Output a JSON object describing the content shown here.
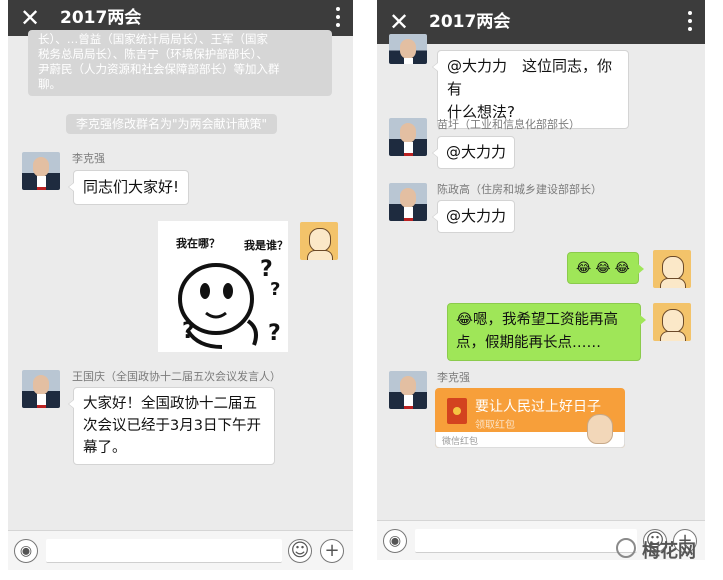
{
  "left": {
    "title": "2017两会",
    "close_icon": "close-icon",
    "more_icon": "more-vertical-icon",
    "sys_join": {
      "lines": [
        "长）、…曾益（国家统计局局长）、王军（国家",
        "税务总局局长）、陈吉宁（环境保护部部长）、",
        "尹蔚民（人力资源和社会保障部部长）等加入群",
        "聊。"
      ]
    },
    "sys_rename": "李克强修改群名为\"为两会献计献策\"",
    "messages": [
      {
        "sender": "李克强",
        "text": "同志们大家好!"
      },
      {
        "sticker": {
          "tag1": "我在哪？",
          "tag2": "我是谁？",
          "marks": [
            "?",
            "?",
            "?",
            "?"
          ]
        }
      },
      {
        "sender": "王国庆（全国政协十二届五次会议发言人）",
        "lines": [
          "大家好！全国政协十二届五",
          "次会议已经于3月3日下午开",
          "幕了。"
        ]
      }
    ],
    "input": {
      "voice_icon": "voice-icon",
      "emoji_icon": "emoji-icon",
      "plus_icon": "plus-icon",
      "voice": "◉",
      "emoji": "☺",
      "plus": "+"
    }
  },
  "right": {
    "title": "2017两会",
    "close_icon": "close-icon",
    "more_icon": "more-vertical-icon",
    "messages": [
      {
        "lines": [
          "@大力力　这位同志，你有",
          "什么想法?"
        ]
      },
      {
        "sender": "苗圩（工业和信息化部部长）",
        "text": "@大力力"
      },
      {
        "sender": "陈政高（住房和城乡建设部部长）",
        "text": "@大力力"
      },
      {
        "text": "😂 😂 😂"
      },
      {
        "lines": [
          "😂嗯，我希望工资能再高",
          "点，假期能再长点……"
        ]
      },
      {
        "sender": "李克强",
        "red_packet": {
          "title": "要让人民过上好日子",
          "sub": "领取红包",
          "footer": "微信红包"
        }
      }
    ],
    "input": {
      "voice_icon": "voice-icon",
      "emoji_icon": "emoji-icon",
      "plus_icon": "plus-icon",
      "voice": "◉",
      "emoji": "☺",
      "plus": "+"
    }
  },
  "watermark": {
    "text": "梅花网",
    "logo_icon": "wechat-logo-icon"
  }
}
